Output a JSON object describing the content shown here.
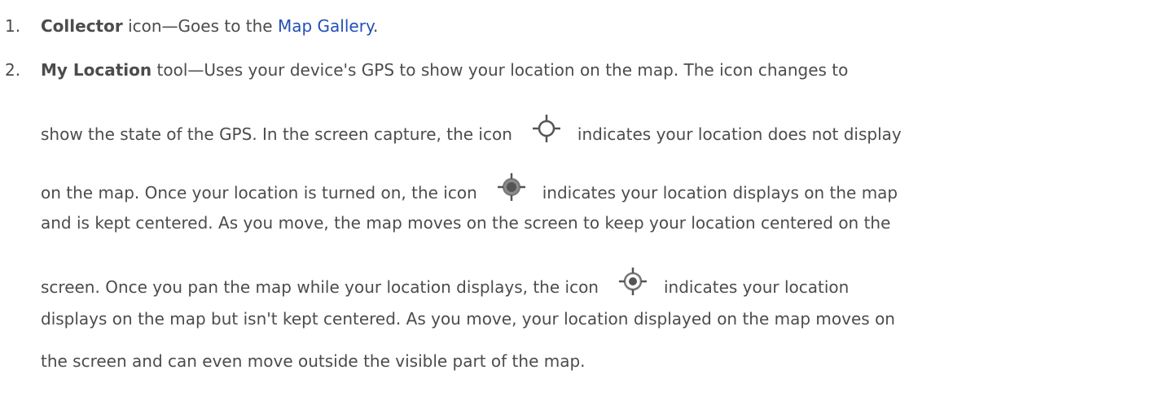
{
  "list": {
    "item1": {
      "number": "1.",
      "title": "Collector",
      "text_before_link": " icon—Goes to the ",
      "link": "Map Gallery",
      "text_after_link": "."
    },
    "item2": {
      "number": "2.",
      "title": "My Location",
      "line1": " tool—Uses your device's GPS to show your location on the map. The icon changes to",
      "line2a": "show the state of the GPS. In the screen capture, the icon",
      "line2b": "indicates your location does not display",
      "line3a": "on the map. Once your location is turned on, the icon",
      "line3b": "indicates your location displays on the map",
      "line4": "and is kept centered. As you move, the map moves on the screen to keep your location centered on the",
      "line5a": "screen. Once you pan the map while your location displays, the icon",
      "line5b": "indicates your location",
      "line6": "displays on the map but isn't kept centered. As you move, your location displayed on the map moves on",
      "line7": "the screen and can even move outside the visible part of the map."
    }
  },
  "icons": {
    "off": "gps-off-icon",
    "centered": "gps-centered-icon",
    "on": "gps-on-icon"
  }
}
